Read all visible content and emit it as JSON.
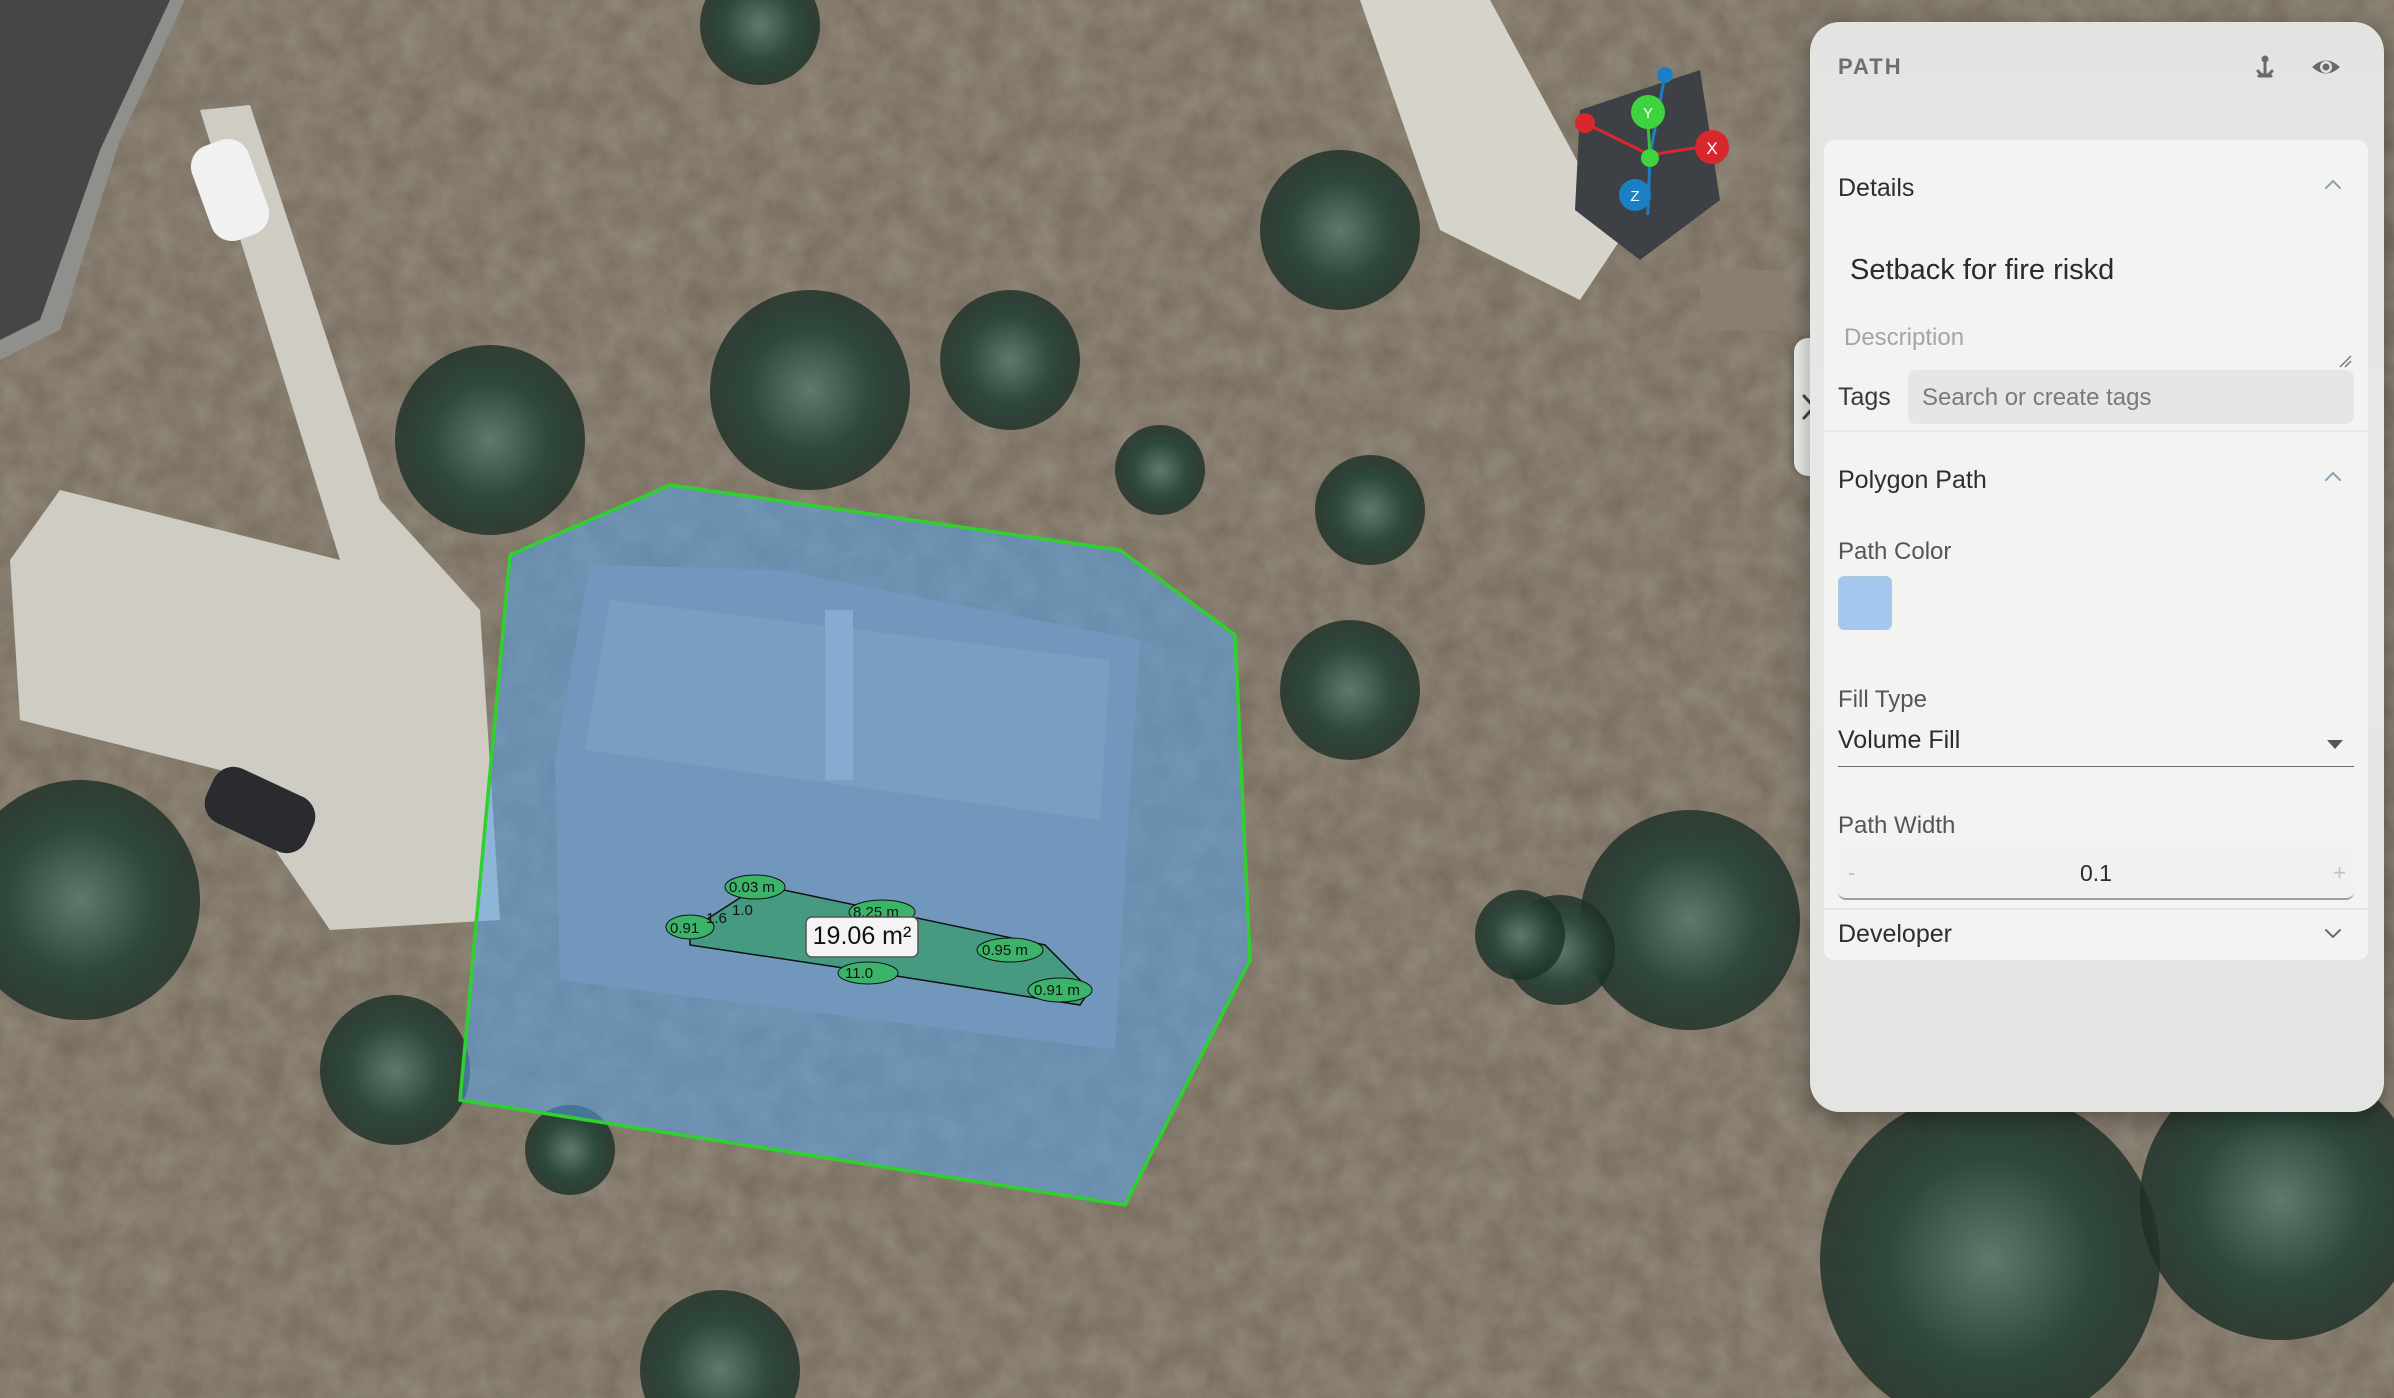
{
  "panel": {
    "title": "PATH",
    "details": {
      "heading": "Details",
      "name_value": "Setback for fire riskd",
      "description_placeholder": "Description",
      "tags_label": "Tags",
      "tags_placeholder": "Search or create tags"
    },
    "polygon_path": {
      "heading": "Polygon Path",
      "path_color_label": "Path Color",
      "path_color": "#a3c7ef",
      "fill_type_label": "Fill Type",
      "fill_type_value": "Volume Fill",
      "path_width_label": "Path Width",
      "path_width_value": "0.1",
      "decrement": "-",
      "increment": "+"
    },
    "developer": {
      "heading": "Developer"
    }
  },
  "map": {
    "area_label": "19.06 m²",
    "segment_labels": [
      "0.03 m",
      "8.25 m",
      "0.91",
      "1.6",
      "1.0",
      "0.95 m",
      "0.91 m",
      "11.0"
    ],
    "gizmo_axes": [
      "Y",
      "X",
      "Z"
    ]
  },
  "colors": {
    "polygon_outline": "#2fd12f",
    "polygon_fill": "#5aa3e8",
    "area_fill": "#2f9b63",
    "accent": "#1b7fc4"
  }
}
